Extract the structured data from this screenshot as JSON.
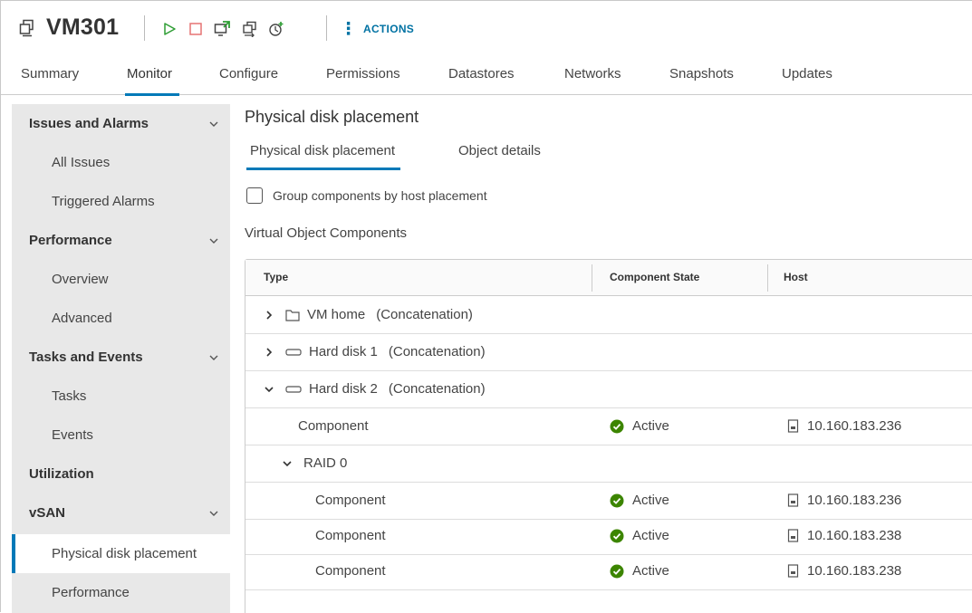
{
  "header": {
    "vm_name": "VM301",
    "toolbar": {
      "icons": [
        "vm-icon",
        "power-on-icon",
        "power-off-icon",
        "launch-console-icon",
        "migrate-icon",
        "snapshot-icon"
      ],
      "actions_label": "ACTIONS"
    }
  },
  "tabs": [
    {
      "label": "Summary"
    },
    {
      "label": "Monitor",
      "active": true
    },
    {
      "label": "Configure"
    },
    {
      "label": "Permissions"
    },
    {
      "label": "Datastores"
    },
    {
      "label": "Networks"
    },
    {
      "label": "Snapshots"
    },
    {
      "label": "Updates"
    }
  ],
  "sidebar": {
    "items": [
      {
        "label": "Issues and Alarms",
        "kind": "group"
      },
      {
        "label": "All Issues",
        "kind": "child"
      },
      {
        "label": "Triggered Alarms",
        "kind": "child"
      },
      {
        "label": "Performance",
        "kind": "group"
      },
      {
        "label": "Overview",
        "kind": "child"
      },
      {
        "label": "Advanced",
        "kind": "child"
      },
      {
        "label": "Tasks and Events",
        "kind": "group"
      },
      {
        "label": "Tasks",
        "kind": "child"
      },
      {
        "label": "Events",
        "kind": "child"
      },
      {
        "label": "Utilization",
        "kind": "group"
      },
      {
        "label": "vSAN",
        "kind": "group"
      },
      {
        "label": "Physical disk placement",
        "kind": "child",
        "active": true
      },
      {
        "label": "Performance",
        "kind": "child"
      }
    ]
  },
  "main": {
    "title": "Physical disk placement",
    "subtabs": [
      {
        "label": "Physical disk placement",
        "active": true
      },
      {
        "label": "Object details"
      }
    ],
    "group_checkbox": {
      "label": "Group components by host placement",
      "checked": false
    },
    "section_label": "Virtual Object Components",
    "grid": {
      "columns": [
        "Type",
        "Component State",
        "Host"
      ],
      "rows": [
        {
          "type": "VM home",
          "strategy": "(Concatenation)",
          "icon": "folder-icon",
          "caret": "collapsed",
          "state": "",
          "host": ""
        },
        {
          "type": "Hard disk 1",
          "strategy": "(Concatenation)",
          "icon": "disk-icon",
          "caret": "collapsed",
          "state": "",
          "host": ""
        },
        {
          "type": "Hard disk 2",
          "strategy": "(Concatenation)",
          "icon": "disk-icon",
          "caret": "expanded",
          "state": "",
          "host": ""
        },
        {
          "type": "Component",
          "strategy": "",
          "state": "Active",
          "host": "10.160.183.236"
        },
        {
          "type": "RAID 0",
          "strategy": "",
          "caret": "expanded",
          "state": "",
          "host": ""
        },
        {
          "type": "Component",
          "strategy": "",
          "state": "Active",
          "host": "10.160.183.236"
        },
        {
          "type": "Component",
          "strategy": "",
          "state": "Active",
          "host": "10.160.183.238"
        },
        {
          "type": "Component",
          "strategy": "",
          "state": "Active",
          "host": "10.160.183.238"
        }
      ]
    }
  },
  "colors": {
    "accent": "#0079b8",
    "actions": "#0072a3",
    "power_on": "#2e9d34",
    "power_off": "#e57373",
    "status_active": "#3c8500",
    "sidebar_bg": "#e8e8e8"
  }
}
